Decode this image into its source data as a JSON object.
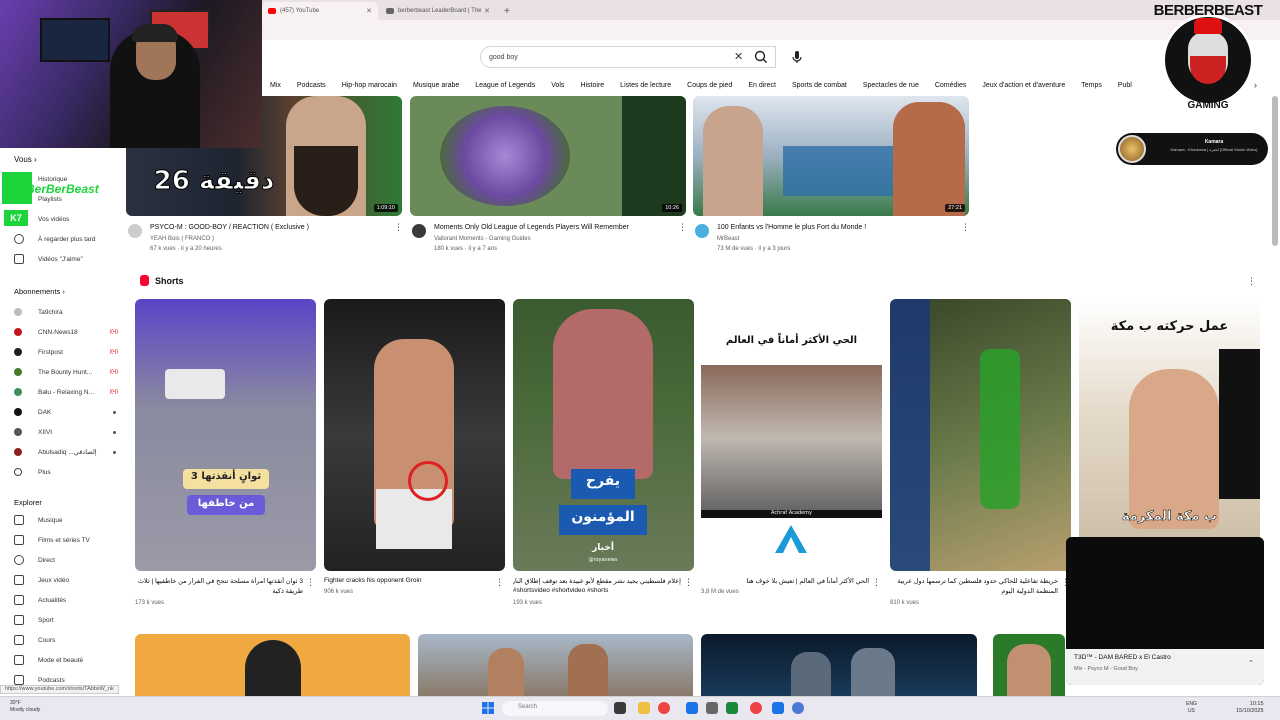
{
  "browser": {
    "tabs": [
      {
        "title": "(457) YouTube",
        "active": true
      },
      {
        "title": "berberbeast LeaderBoard | The",
        "active": false
      }
    ],
    "new_tab": "+"
  },
  "header": {
    "search_value": "good boy",
    "clear_glyph": "✕"
  },
  "chips": [
    "Mix",
    "Podcasts",
    "Hip-hop marocain",
    "Musique arabe",
    "League of Legends",
    "Vols",
    "Histoire",
    "Listes de lecture",
    "Coups de pied",
    "En direct",
    "Sports de combat",
    "Spectacles de rue",
    "Comédies",
    "Jeux d'action et d'aventure",
    "Temps",
    "Publ"
  ],
  "chips_next": "›",
  "sidebar": {
    "you_header": "Vous",
    "you_items": [
      "Historique",
      "Playlists",
      "Vos vidéos",
      "À regarder plus tard",
      "Vidéos \"J'aime\""
    ],
    "subs_header": "Abonnements",
    "subs": [
      {
        "name": "Ta9chira",
        "color": "#bbbbbb",
        "live": false,
        "dot": false
      },
      {
        "name": "CNN-News18",
        "color": "#c4161c",
        "live": true,
        "dot": false
      },
      {
        "name": "Firstpost",
        "color": "#1d1d1d",
        "live": true,
        "dot": false
      },
      {
        "name": "The Bounty Hunt...",
        "color": "#4a7a2a",
        "live": true,
        "dot": false
      },
      {
        "name": "Balu - Relaxing N...",
        "color": "#3e8e5e",
        "live": true,
        "dot": false
      },
      {
        "name": "DAK",
        "color": "#111111",
        "live": false,
        "dot": true
      },
      {
        "name": "XIIVI",
        "color": "#555555",
        "live": false,
        "dot": true
      },
      {
        "name": "Abulsadiq ...ﺇﻟﺼﺎﺩﻗﻲ",
        "color": "#8a2020",
        "live": false,
        "dot": true
      },
      {
        "name": "Plus",
        "color": "#999999",
        "live": false,
        "dot": false
      }
    ],
    "explore_header": "Explorer",
    "explore_items": [
      "Musique",
      "Films et séries TV",
      "Direct",
      "Jeux vidéo",
      "Actualités",
      "Sport",
      "Cours",
      "Mode et beauté",
      "Podcasts"
    ]
  },
  "overlay": {
    "twitch_text": "BerBerBeast",
    "k7": "K7",
    "logo_name": "BERBERBEAST",
    "logo_sub": "GAMING"
  },
  "now_playing": {
    "title": "Kamara",
    "subtitle": "Kamara - Khoubeza | لخبزة (Official Music Video)"
  },
  "videos": [
    {
      "title": "PSYCO-M : GOOD-BOY / REACTION ( Exclusive )",
      "channel": "YEAH Bois ( FRANCO )",
      "meta": "67 k vues · il y a 20 heures",
      "duration": "1:09:10",
      "overlay": "26 دقيقة"
    },
    {
      "title": "Moments Only Old League of Legends Players Will Remember",
      "channel": "Vallorant Moments - Gaming Guides",
      "meta": "180 k vues · il y a 7 ans",
      "duration": "10:26"
    },
    {
      "title": "100 Enfants vs l'Homme le plus Fort du Monde !",
      "channel": "MrBeast",
      "meta": "73 M de vues · il y a 3 jours",
      "duration": "27:21"
    }
  ],
  "shorts": {
    "header": "Shorts",
    "items": [
      {
        "title": "3 ثوان أنقذتها امرأة مسلحة تنجح في الفرار من خاطفيها | ثلاث",
        "title2": "طريقة ذكية",
        "views": "173 k vues",
        "ar1": "3 ثوانٍ أنقذتها",
        "ar2": "من خاطفها"
      },
      {
        "title": "Fighter cracks his opponent Groin",
        "title2": "",
        "views": "906 k vues"
      },
      {
        "title": "إعلام فلسطيني يجيد نشر مقطع لأبو عبيدة بعد توقف إطلاق النار",
        "title2": "#shortsvideo #shortvideo #shorts",
        "views": "193 k vues",
        "ar1": "يفرح",
        "ar2": "المؤمنون",
        "brand": "أخبار",
        "handle": "@royanews"
      },
      {
        "title": "الحي الأكثر أماناً في العالم | تعيش بلا خوف هنا",
        "title2": "",
        "views": "3,8 M de vues",
        "ar1": "الحي الأكثر أماناً في العالم",
        "brand": "Achraf Academy"
      },
      {
        "title": "خريطة تفاعلية للحاكي حدود فلسطين كما ترسمها دول عربية",
        "title2": "المنظمة الدولية اليوم",
        "views": "810 k vues"
      },
      {
        "title": "",
        "title2": "",
        "views": "",
        "ar1": "عمل حركته ب مكة",
        "ar2": "ب مكة المكرمة"
      }
    ]
  },
  "mini_player": {
    "title": "T3D™ - DAM BARED x El Castro",
    "subtitle": "Mix - Psyco M - Good Boy",
    "chevron": "⌃"
  },
  "status_url": "https://www.youtube.com/shorts/TAbbsW_nk",
  "taskbar": {
    "weather": "30°F",
    "weather2": "Mostly cloudy",
    "search": "Search",
    "lang": "ENG",
    "lang2": "US",
    "time": "10:15",
    "date": "15/10/2025"
  }
}
